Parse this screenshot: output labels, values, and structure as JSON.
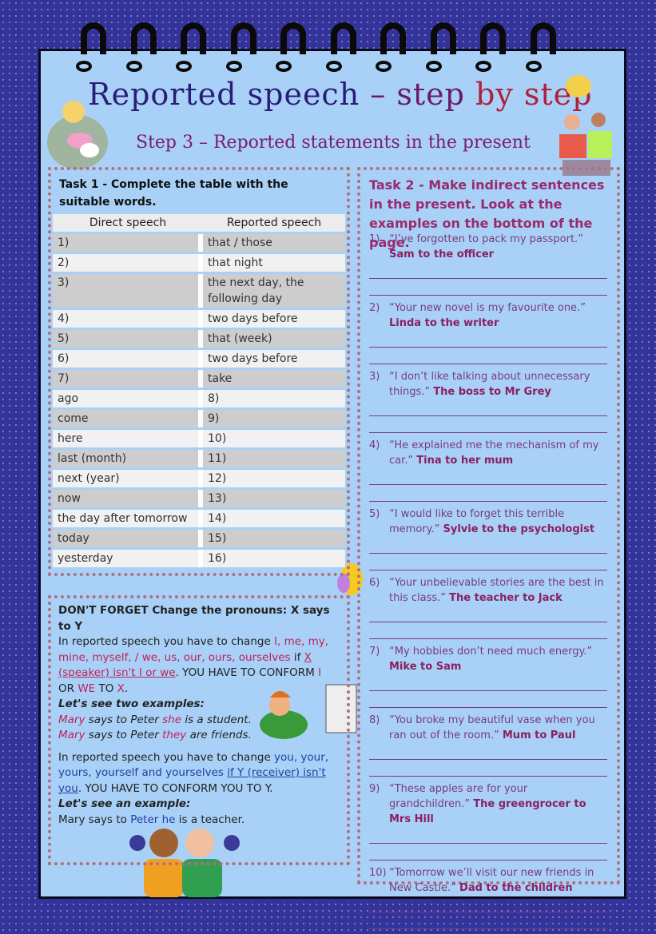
{
  "header": {
    "title_part1": "Reported speech ",
    "title_part2": "– step ",
    "title_part3": "by step",
    "subtitle": "Step 3 – Reported statements in the present"
  },
  "task1": {
    "title": "Task 1 - Complete the table with the suitable words.",
    "columns": [
      "Direct speech",
      "Reported speech"
    ],
    "rows": [
      [
        "1)",
        "that / those"
      ],
      [
        "2)",
        "that night"
      ],
      [
        "3)",
        "the next day, the following day"
      ],
      [
        "4)",
        "two days before"
      ],
      [
        "5)",
        "that (week)"
      ],
      [
        "6)",
        "two days before"
      ],
      [
        "7)",
        "take"
      ],
      [
        "ago",
        "8)"
      ],
      [
        "come",
        "9)"
      ],
      [
        "here",
        "10)"
      ],
      [
        "last (month)",
        "11)"
      ],
      [
        "next (year)",
        "12)"
      ],
      [
        "now",
        "13)"
      ],
      [
        "the day after tomorrow",
        "14)"
      ],
      [
        "today",
        "15)"
      ],
      [
        "yesterday",
        "16)"
      ]
    ]
  },
  "task2": {
    "title": "Task 2 - Make indirect sentences in the present. Look at the examples on the bottom of the page.",
    "items": [
      {
        "num": "1)",
        "quote": "“I’ve forgotten to pack my passport.”",
        "who": "Sam to the officer"
      },
      {
        "num": "2)",
        "quote": "“Your new novel is my favourite one.”",
        "who": "Linda to the writer"
      },
      {
        "num": "3)",
        "quote": "“I don’t like talking about unnecessary things.”",
        "who": "The boss to Mr Grey"
      },
      {
        "num": "4)",
        "quote": "“He explained me the mechanism of my car.”",
        "who": "Tina to her mum"
      },
      {
        "num": "5)",
        "quote": "“I would like to forget this terrible memory.”",
        "who": "Sylvie to the psychologist"
      },
      {
        "num": "6)",
        "quote": "“Your unbelievable stories are the best in this class.”",
        "who": "The teacher to Jack"
      },
      {
        "num": "7)",
        "quote": "“My hobbies don’t need much energy.”",
        "who": "Mike to Sam"
      },
      {
        "num": "8)",
        "quote": "“You broke my beautiful vase when you ran out of the room.”",
        "who": "Mum to Paul"
      },
      {
        "num": "9)",
        "quote": "“These apples are for your grandchildren.”",
        "who": "The greengrocer to Mrs Hill"
      },
      {
        "num": "10)",
        "quote": "“Tomorrow we’ll visit our new friends in New Castle.”",
        "who": "Dad to the children"
      }
    ]
  },
  "note": {
    "heading": "DON'T FORGET Change the pronouns: X says to Y",
    "p1_a": "In reported speech you have to change ",
    "p1_pronouns": "I, me, my, mine, myself, / we, us, our, ours, ourselves",
    "p1_b": " if ",
    "p1_cond": "X (speaker) isn't I or we",
    "p1_c": ". YOU HAVE TO CONFORM ",
    "p1_d": "I",
    "p1_e": " OR ",
    "p1_f": "WE",
    "p1_g": " TO ",
    "p1_h": "X",
    "p1_i": ".",
    "ex_heading1": "Let's see two examples:",
    "ex1_a": "Mary",
    "ex1_b": " says to Peter ",
    "ex1_c": "she",
    "ex1_d": " is a  student.",
    "ex2_a": "Mary",
    "ex2_b": " says to Peter ",
    "ex2_c": "they",
    "ex2_d": " are friends.",
    "p2_a": "In reported speech you have to change ",
    "p2_pronouns": "you, your, yours, yourself and yourselves",
    "p2_b": " ",
    "p2_cond": "if Y (receiver) isn't you",
    "p2_c": ". YOU HAVE TO CONFORM YOU TO Y.",
    "ex_heading2": "Let's see an example:",
    "ex3_a": "Mary says to ",
    "ex3_b": "Peter he",
    "ex3_c": " is a teacher."
  },
  "colors": {
    "background": "#33339a",
    "page": "#a9d1f7",
    "task2_text": "#9a2a6e",
    "pronoun_red": "#c0205a",
    "pronoun_blue": "#2040a0"
  }
}
